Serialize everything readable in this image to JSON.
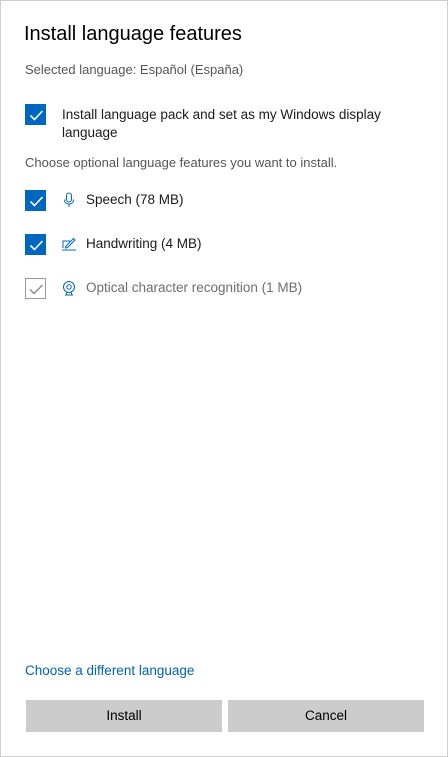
{
  "dialog": {
    "title": "Install language features",
    "selected_language": "Selected language: Español (España)"
  },
  "primary_option": {
    "label": "Install language pack and set as my Windows display language",
    "checked": true
  },
  "optional_hint": "Choose optional language features you want to install.",
  "features": [
    {
      "label": "Speech (78 MB)",
      "icon": "microphone-icon",
      "checked": true,
      "enabled": true
    },
    {
      "label": "Handwriting (4 MB)",
      "icon": "pen-icon",
      "checked": true,
      "enabled": true
    },
    {
      "label": "Optical character recognition (1 MB)",
      "icon": "ocr-camera-icon",
      "checked": true,
      "enabled": false
    }
  ],
  "footer": {
    "change_language_link": "Choose a different language",
    "install_label": "Install",
    "cancel_label": "Cancel"
  },
  "colors": {
    "accent": "#0067c0",
    "link": "#0063b1",
    "button_bg": "#cccccc",
    "disabled": "#9a9a9a"
  }
}
